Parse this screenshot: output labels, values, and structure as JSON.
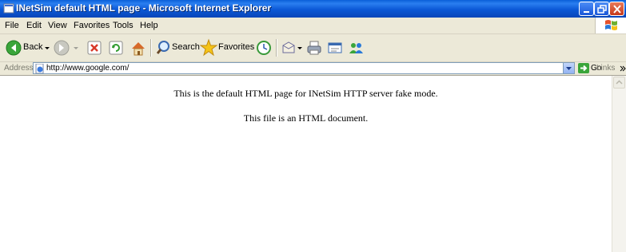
{
  "window": {
    "title": "INetSim default HTML page - Microsoft Internet Explorer"
  },
  "menu": {
    "items": [
      "File",
      "Edit",
      "View",
      "Favorites",
      "Tools",
      "Help"
    ]
  },
  "toolbar": {
    "back_label": "Back",
    "search_label": "Search",
    "favorites_label": "Favorites"
  },
  "address": {
    "label": "Address",
    "value": "http://www.google.com/",
    "go_label": "Go",
    "links_label": "Links"
  },
  "page": {
    "line1": "This is the default HTML page for INetSim HTTP server fake mode.",
    "line2": "This file is an HTML document."
  },
  "colors": {
    "titlebar": "#0a5fd8",
    "chrome": "#ece9d8",
    "close_button": "#c5391b"
  }
}
